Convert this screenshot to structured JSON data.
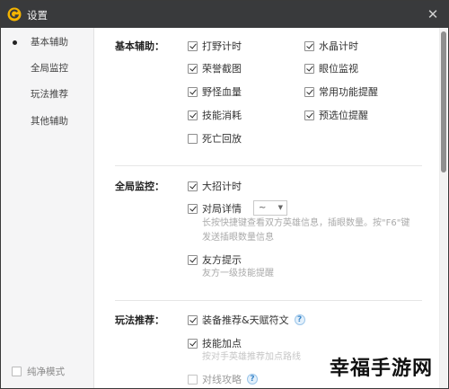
{
  "window": {
    "title": "设置",
    "close_label": "✕"
  },
  "sidebar": {
    "items": [
      {
        "label": "基本辅助",
        "active": true
      },
      {
        "label": "全局监控",
        "active": false
      },
      {
        "label": "玩法推荐",
        "active": false
      },
      {
        "label": "其他辅助",
        "active": false
      }
    ],
    "pure_mode_label": "纯净模式"
  },
  "basic": {
    "label": "基本辅助：",
    "options": [
      {
        "label": "打野计时",
        "checked": true
      },
      {
        "label": "水晶计时",
        "checked": true
      },
      {
        "label": "荣誉截图",
        "checked": true
      },
      {
        "label": "眼位监视",
        "checked": true
      },
      {
        "label": "野怪血量",
        "checked": true
      },
      {
        "label": "常用功能提醒",
        "checked": true
      },
      {
        "label": "技能消耗",
        "checked": true
      },
      {
        "label": "预选位提醒",
        "checked": true
      },
      {
        "label": "死亡回放",
        "checked": false
      }
    ]
  },
  "monitor": {
    "label": "全局监控：",
    "ult_timer": {
      "label": "大招计时",
      "checked": true
    },
    "match_detail": {
      "label": "对局详情",
      "checked": true,
      "dropdown_value": "~",
      "desc_line1": "长按快捷键查看双方英雄信息，插眼数量。按\"F6\"键",
      "desc_line2": "发送插眼数量信息"
    },
    "ally_hint": {
      "label": "友方提示",
      "checked": true,
      "desc": "友方一级技能提醒"
    }
  },
  "gameplay": {
    "label": "玩法推荐：",
    "equip_rune": {
      "label": "装备推荐&天赋符文",
      "checked": true,
      "help": "?"
    },
    "skill_points": {
      "label": "技能加点",
      "checked": true,
      "desc": "按对手英雄推荐加点路线"
    },
    "counter": {
      "label": "对线攻略",
      "checked": false,
      "help": "?"
    }
  },
  "watermark": {
    "text": "幸福手游网"
  }
}
